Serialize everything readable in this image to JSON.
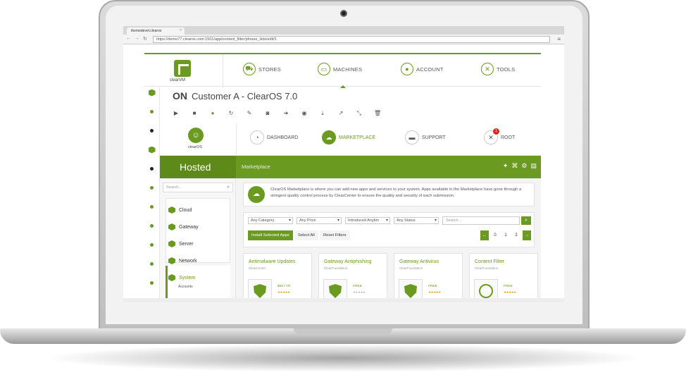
{
  "browser": {
    "tab_title": "themedevel.clearos",
    "url": "https://demo77.clearos.com:1501/app/content_filter/phrase_lists/edit/1"
  },
  "clearvm": {
    "logo_text": "clearVM",
    "nav": [
      {
        "label": "STORES",
        "icon": "cart-icon"
      },
      {
        "label": "MACHINES",
        "icon": "machine-icon"
      },
      {
        "label": "ACCOUNT",
        "icon": "user-icon"
      },
      {
        "label": "TOOLS",
        "icon": "tools-icon"
      }
    ],
    "status": "ON",
    "machine_name": "Customer A - ClearOS 7.0"
  },
  "clearos": {
    "logo_text": "clearOS",
    "nav": [
      {
        "label": "DASHBOARD"
      },
      {
        "label": "MARKETPLACE"
      },
      {
        "label": "SUPPORT"
      },
      {
        "label": "ROOT",
        "badge": "1"
      }
    ],
    "section": "Hosted",
    "page_title": "Marketplace",
    "search_placeholder": "Search...",
    "sidebar": [
      "Cloud",
      "Gateway",
      "Server",
      "Network",
      "System"
    ],
    "sidebar_sub": "Accounts",
    "info_text": "ClearOS Marketplace is where you can add new apps and services to your system. Apps available in the Marketplace have gone through a stringent quality control process by ClearCenter to ensure the quality and security of each submission.",
    "filters": {
      "category": "Any Category",
      "price": "Any Price",
      "introduced": "Introduced Anytim",
      "status": "Any Status",
      "search_placeholder": "Search..."
    },
    "buttons": {
      "install": "Install Selected Apps",
      "select_all": "Select All",
      "reset": "Reset Filters"
    },
    "pagination": [
      "0",
      "1",
      "2"
    ],
    "apps": [
      {
        "title": "Antimalware Updates",
        "vendor": "ClearCenter",
        "price": "$50 / YR",
        "rating": "★★★★★"
      },
      {
        "title": "Gateway Antiphishing",
        "vendor": "ClearFoundation",
        "price": "FREE",
        "rating": "★★★★★"
      },
      {
        "title": "Gateway Antivirus",
        "vendor": "ClearFoundation",
        "price": "FREE",
        "rating": "★★★★★"
      },
      {
        "title": "Content Filter",
        "vendor": "ClearFoundation",
        "price": "FREE",
        "rating": "★★★★★"
      }
    ]
  },
  "colors": {
    "accent": "#6a9a1f",
    "badge": "#d9281f"
  }
}
